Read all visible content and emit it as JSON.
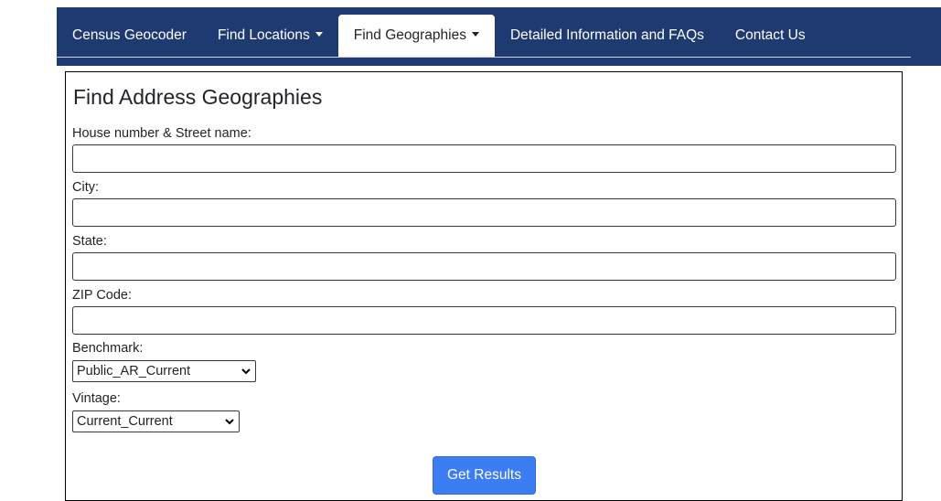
{
  "nav": {
    "items": [
      {
        "label": "Census Geocoder",
        "dropdown": false,
        "active": false
      },
      {
        "label": "Find Locations",
        "dropdown": true,
        "active": false
      },
      {
        "label": "Find Geographies",
        "dropdown": true,
        "active": true
      },
      {
        "label": "Detailed Information and FAQs",
        "dropdown": false,
        "active": false
      },
      {
        "label": "Contact Us",
        "dropdown": false,
        "active": false
      }
    ]
  },
  "form": {
    "title": "Find Address Geographies",
    "street_label": "House number & Street name:",
    "street_value": "",
    "city_label": "City:",
    "city_value": "",
    "state_label": "State:",
    "state_value": "",
    "zip_label": "ZIP Code:",
    "zip_value": "",
    "benchmark_label": "Benchmark:",
    "benchmark_value": "Public_AR_Current",
    "vintage_label": "Vintage:",
    "vintage_value": "Current_Current",
    "submit_label": "Get Results"
  },
  "colors": {
    "nav_background": "#1f3a70",
    "button_background": "#3d7df2"
  }
}
